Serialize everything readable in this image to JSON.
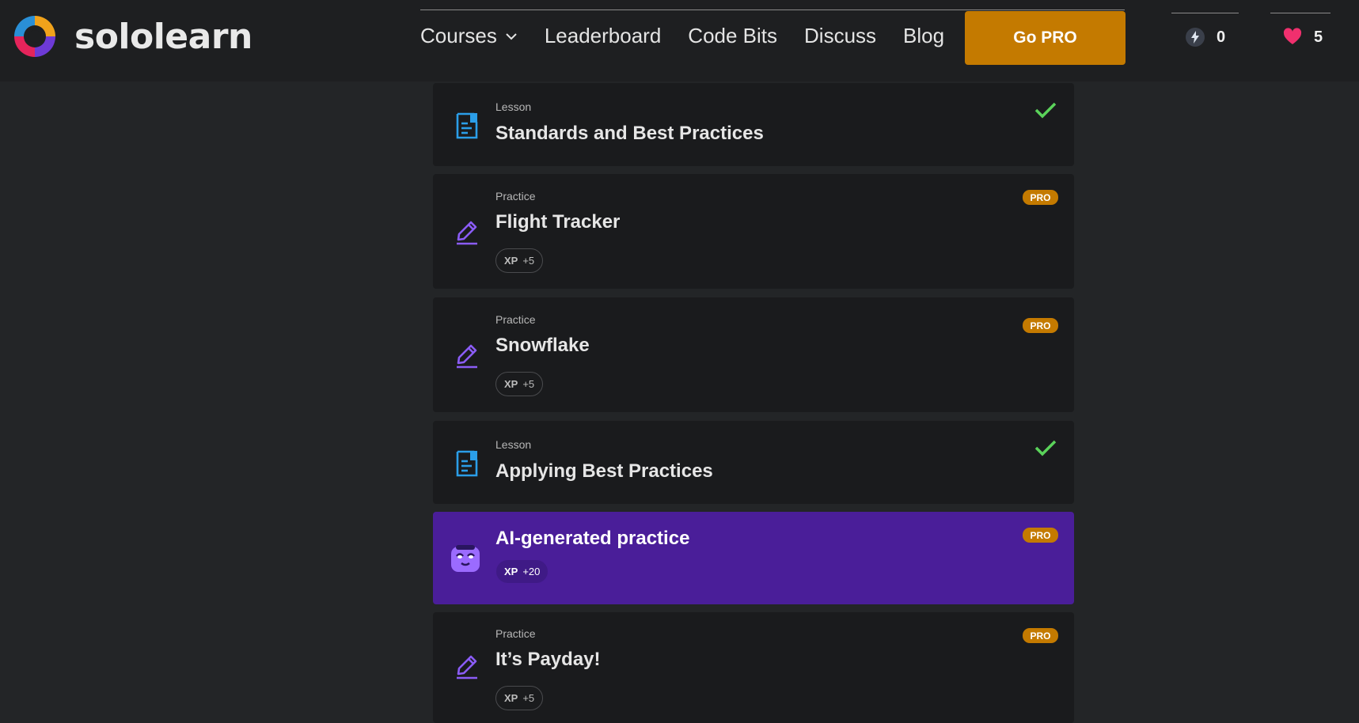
{
  "brand": {
    "name": "sololearn",
    "logo_icon": "sololearn-logo-icon"
  },
  "nav": {
    "items": [
      {
        "label": "Courses",
        "has_dropdown": true
      },
      {
        "label": "Leaderboard"
      },
      {
        "label": "Code Bits"
      },
      {
        "label": "Discuss"
      },
      {
        "label": "Blog"
      }
    ],
    "go_pro_label": "Go PRO"
  },
  "stats": {
    "streak": {
      "icon": "lightning-icon",
      "value": "0"
    },
    "hearts": {
      "icon": "heart-icon",
      "value": "5"
    }
  },
  "colors": {
    "accent_orange": "#c47a00",
    "ai_purple": "#4a1e99",
    "check_green": "#5ad35a",
    "lesson_blue": "#2b9ee8",
    "practice_purple": "#8b5cf6",
    "heart_pink": "#f0306e"
  },
  "items": [
    {
      "kind": "Lesson",
      "title": "Standards and Best Practices",
      "completed": true,
      "icon": "lesson-icon"
    },
    {
      "kind": "Practice",
      "title": "Flight Tracker",
      "pro": "PRO",
      "xp_label": "XP",
      "xp_value": "+5",
      "icon": "practice-pencil-icon"
    },
    {
      "kind": "Practice",
      "title": "Snowflake",
      "pro": "PRO",
      "xp_label": "XP",
      "xp_value": "+5",
      "icon": "practice-pencil-icon"
    },
    {
      "kind": "Lesson",
      "title": "Applying Best Practices",
      "completed": true,
      "icon": "lesson-icon"
    },
    {
      "kind": "",
      "title": "AI-generated practice",
      "pro": "PRO",
      "xp_label": "XP",
      "xp_value": "+20",
      "icon": "ai-mascot-icon"
    },
    {
      "kind": "Practice",
      "title": "It’s Payday!",
      "pro": "PRO",
      "xp_label": "XP",
      "xp_value": "+5",
      "icon": "practice-pencil-icon"
    }
  ]
}
